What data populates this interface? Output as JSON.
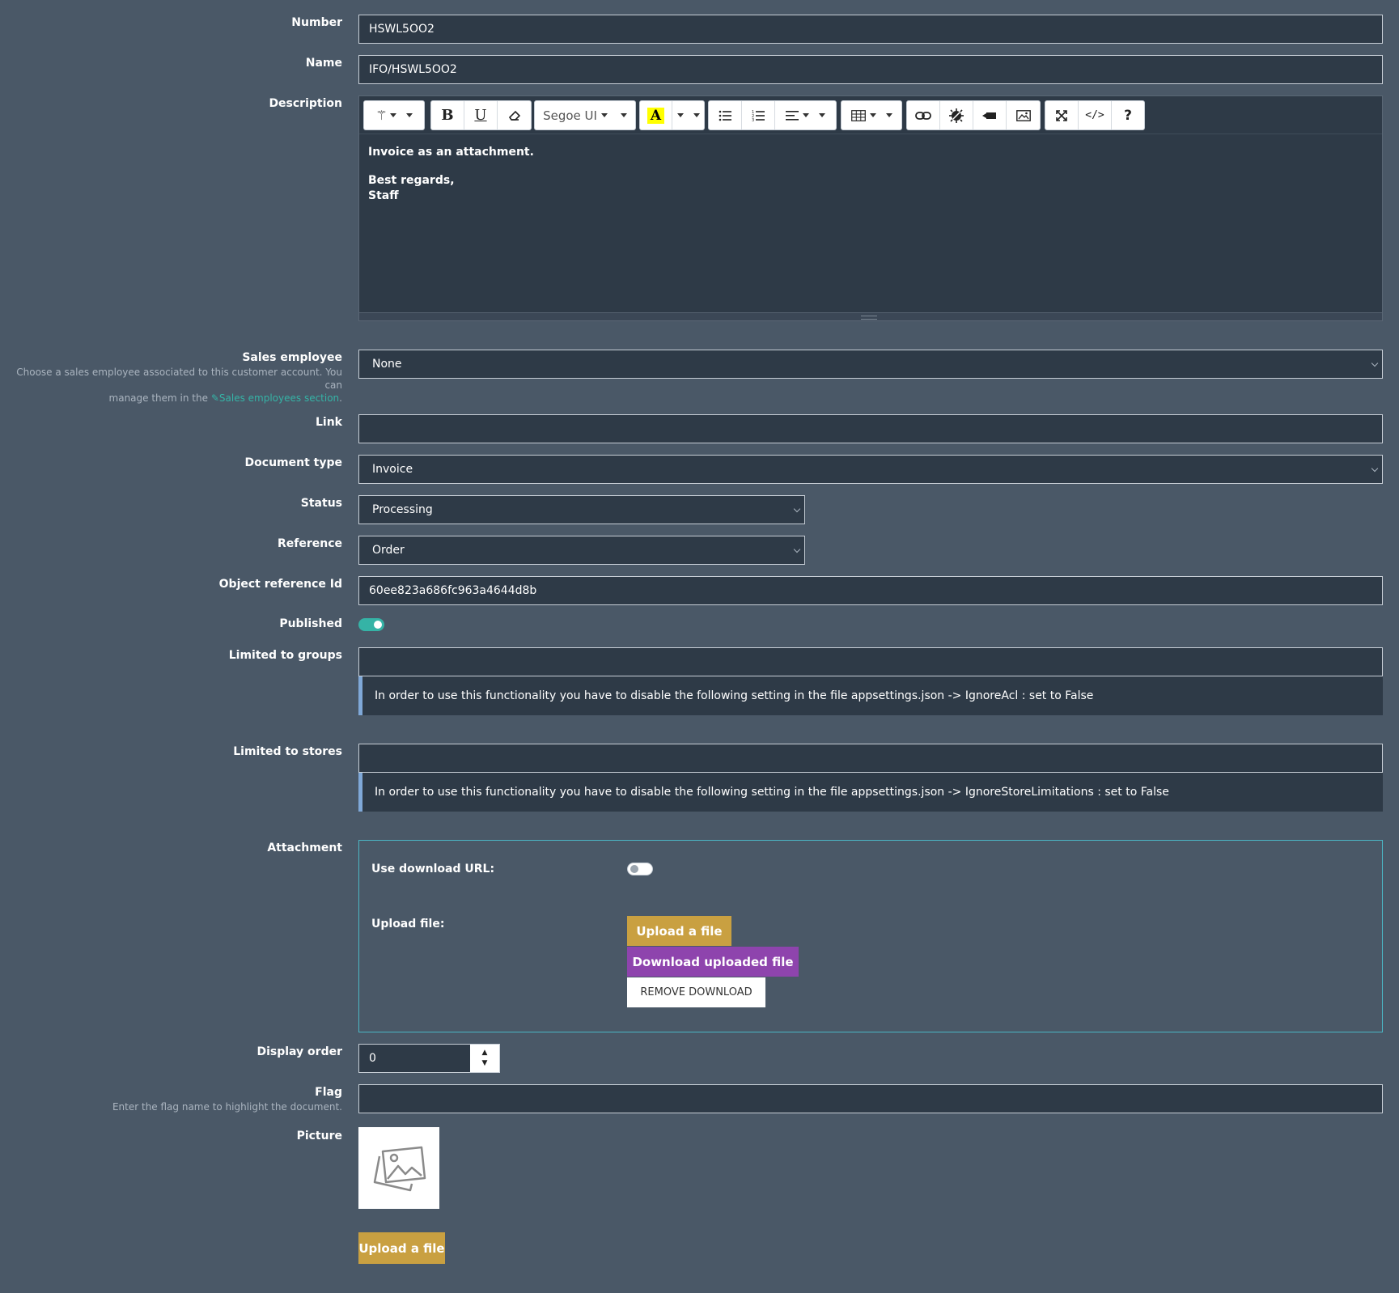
{
  "fields": {
    "number": {
      "label": "Number",
      "value": "HSWL5OO2"
    },
    "name": {
      "label": "Name",
      "value": "IFO/HSWL5OO2"
    },
    "description": {
      "label": "Description",
      "font_name": "Segoe UI",
      "body_line1": "Invoice as an attachment.",
      "body_line2": "Best regards,",
      "body_line3": "Staff"
    },
    "sales_employee": {
      "label": "Sales employee",
      "value": "None",
      "hint_line1": "Choose a sales employee associated to this customer account. You can",
      "hint_line2_prefix": "manage them in the",
      "hint_link": "Sales employees section",
      "hint_suffix": "."
    },
    "link": {
      "label": "Link",
      "value": ""
    },
    "document_type": {
      "label": "Document type",
      "value": "Invoice"
    },
    "status": {
      "label": "Status",
      "value": "Processing"
    },
    "reference": {
      "label": "Reference",
      "value": "Order"
    },
    "object_reference_id": {
      "label": "Object reference Id",
      "value": "60ee823a686fc963a4644d8b"
    },
    "published": {
      "label": "Published",
      "on": true
    },
    "limited_to_groups": {
      "label": "Limited to groups",
      "notice": "In order to use this functionality you have to disable the following setting in the file appsettings.json -> IgnoreAcl : set to False"
    },
    "limited_to_stores": {
      "label": "Limited to stores",
      "notice": "In order to use this functionality you have to disable the following setting in the file appsettings.json -> IgnoreStoreLimitations : set to False"
    },
    "attachment": {
      "label": "Attachment",
      "use_download_url_label": "Use download URL:",
      "use_download_url_on": false,
      "upload_file_label": "Upload file:",
      "upload_button": "Upload a file",
      "download_button": "Download uploaded file",
      "remove_button": "REMOVE DOWNLOAD"
    },
    "display_order": {
      "label": "Display order",
      "value": "0"
    },
    "flag": {
      "label": "Flag",
      "value": "",
      "hint": "Enter the flag name to highlight the document."
    },
    "picture": {
      "label": "Picture",
      "upload_button": "Upload a file",
      "icon": "image-placeholder-icon"
    }
  },
  "colors": {
    "background": "#4a5867",
    "input_bg": "#2e3a47",
    "accent_teal": "#35b3a6",
    "upload_gold": "#c9a041",
    "download_purple": "#8e44ad",
    "notice_border": "#7fa8d8",
    "attachment_border": "#4bb6c4"
  }
}
